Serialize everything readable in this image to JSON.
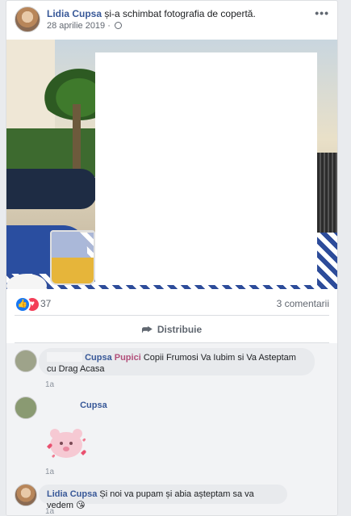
{
  "post": {
    "author": "Lidia Cupsa",
    "action": "și-a schimbat fotografia de copertă.",
    "date": "28 aprilie 2019",
    "separator": "·",
    "more_icon": "more-horizontal-icon"
  },
  "stats": {
    "reaction_count": "37",
    "comments_label": "3 comentarii"
  },
  "actions": {
    "share_label": "Distribuie",
    "share_icon": "share-arrow-icon"
  },
  "comments": [
    {
      "author_first": "Cupsa",
      "author_second": "Pupici",
      "text": "Copii Frumosi Va Iubim si Va Asteptam cu Drag Acasa",
      "time": "1a"
    },
    {
      "author_first": "Cupsa",
      "sticker": "pink-bear-hearts-sticker",
      "time": "1a"
    },
    {
      "author_first": "Lidia Cupsa",
      "text": "Și noi va pupam și abia așteptam sa va vedem",
      "emoji": "😘",
      "time": "1a"
    }
  ],
  "colors": {
    "link": "#385898",
    "background": "#e9ebee",
    "like": "#1877f2",
    "love": "#f33e58",
    "bubble": "#e8eaed"
  }
}
